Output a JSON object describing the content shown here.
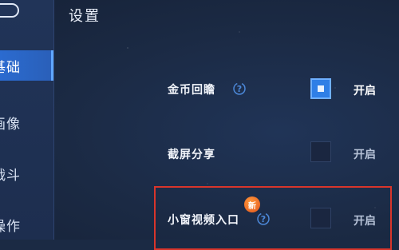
{
  "header": {
    "title": "设置"
  },
  "sidebar": {
    "items": [
      {
        "label": "基础",
        "active": true
      },
      {
        "label": "画像",
        "active": false
      },
      {
        "label": "战斗",
        "active": false
      },
      {
        "label": "操作",
        "active": false
      }
    ]
  },
  "settings": [
    {
      "label": "金币回瞻",
      "has_help": true,
      "checked": true,
      "status": "开启"
    },
    {
      "label": "截屏分享",
      "has_help": false,
      "checked": false,
      "status": "开启"
    },
    {
      "label": "小窗视频入口",
      "has_help": true,
      "checked": false,
      "status": "开启",
      "badge": "新"
    }
  ],
  "colors": {
    "accent": "#2f7fe6",
    "highlight": "#d8352b",
    "badge": "#e3541b"
  }
}
